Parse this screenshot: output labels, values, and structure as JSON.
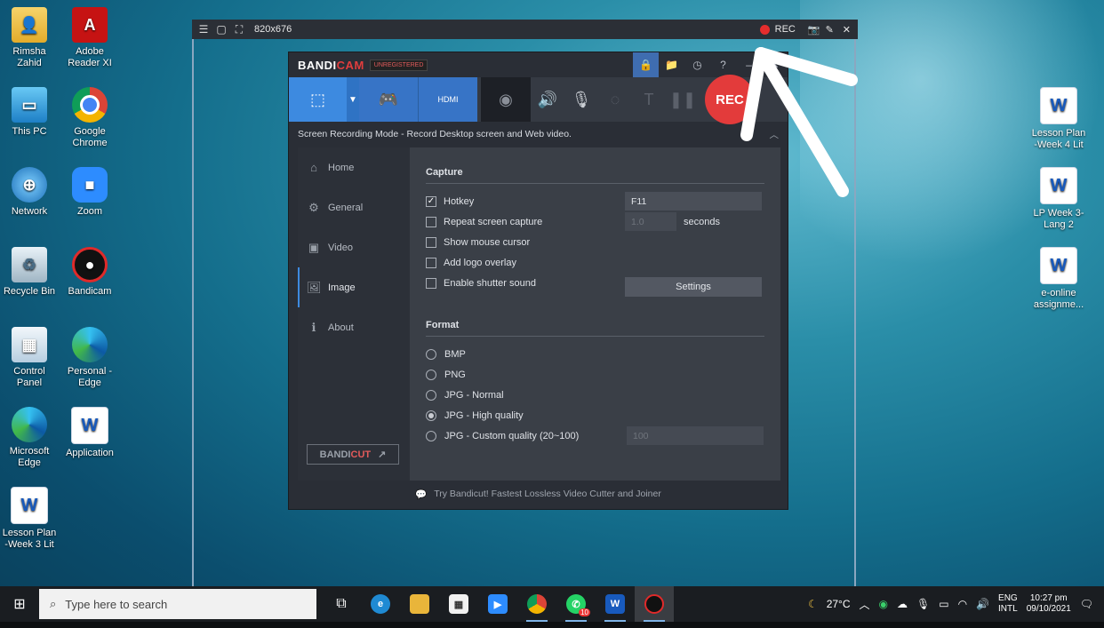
{
  "desktop": {
    "icons": [
      {
        "label": "Rimsha Zahid",
        "icon": "user-folder-icon"
      },
      {
        "label": "Adobe Reader XI",
        "icon": "pdf-icon"
      },
      {
        "label": "This PC",
        "icon": "computer-icon"
      },
      {
        "label": "Google Chrome",
        "icon": "chrome-icon"
      },
      {
        "label": "Network",
        "icon": "network-icon"
      },
      {
        "label": "Zoom",
        "icon": "zoom-icon"
      },
      {
        "label": "Recycle Bin",
        "icon": "recycle-bin-icon"
      },
      {
        "label": "Bandicam",
        "icon": "bandicam-icon"
      },
      {
        "label": "Control Panel",
        "icon": "control-panel-icon"
      },
      {
        "label": "Personal - Edge",
        "icon": "edge-icon"
      },
      {
        "label": "Microsoft Edge",
        "icon": "edge-icon"
      },
      {
        "label": "Application",
        "icon": "word-doc-icon"
      },
      {
        "label": "Lesson Plan -Week 3 Lit",
        "icon": "word-doc-icon"
      },
      {
        "label": "Lesson Plan -Week 4 Lit",
        "icon": "word-doc-icon"
      },
      {
        "label": "LP Week 3-Lang 2",
        "icon": "word-doc-icon"
      },
      {
        "label": "e-online assignme...",
        "icon": "word-doc-icon"
      }
    ]
  },
  "recorder_bar": {
    "size": "820x676",
    "rec_label": "REC"
  },
  "bandicam": {
    "logo_main": "BANDI",
    "logo_accent": "CAM",
    "unregistered": "UNREGISTERED",
    "mode_text": "Screen Recording Mode - Record Desktop screen and Web video.",
    "rec_button": "REC",
    "tab_hdmi": "HDMI",
    "sidebar": [
      {
        "label": "Home",
        "icon": "home-icon"
      },
      {
        "label": "General",
        "icon": "gear-icon"
      },
      {
        "label": "Video",
        "icon": "video-icon"
      },
      {
        "label": "Image",
        "icon": "image-icon"
      },
      {
        "label": "About",
        "icon": "info-icon"
      }
    ],
    "bandicut_main": "BANDI",
    "bandicut_accent": "CUT",
    "capture": {
      "title": "Capture",
      "hotkey_label": "Hotkey",
      "hotkey_value": "F11",
      "hotkey_checked": true,
      "repeat_label": "Repeat screen capture",
      "repeat_value": "1.0",
      "repeat_unit": "seconds",
      "mouse_label": "Show mouse cursor",
      "logo_label": "Add logo overlay",
      "shutter_label": "Enable shutter sound",
      "settings_button": "Settings"
    },
    "format": {
      "title": "Format",
      "options": [
        "BMP",
        "PNG",
        "JPG - Normal",
        "JPG - High quality",
        "JPG - Custom quality (20~100)"
      ],
      "selected_index": 3,
      "custom_value": "100"
    },
    "footer": "Try Bandicut! Fastest Lossless Video Cutter and Joiner"
  },
  "taskbar": {
    "search_placeholder": "Type here to search",
    "whatsapp_badge": "10",
    "weather": "27°C",
    "lang1": "ENG",
    "lang2": "INTL",
    "time": "10:27 pm",
    "date": "09/10/2021"
  },
  "colors": {
    "accent_blue": "#3d8ae0",
    "rec_red": "#e33b3b"
  }
}
